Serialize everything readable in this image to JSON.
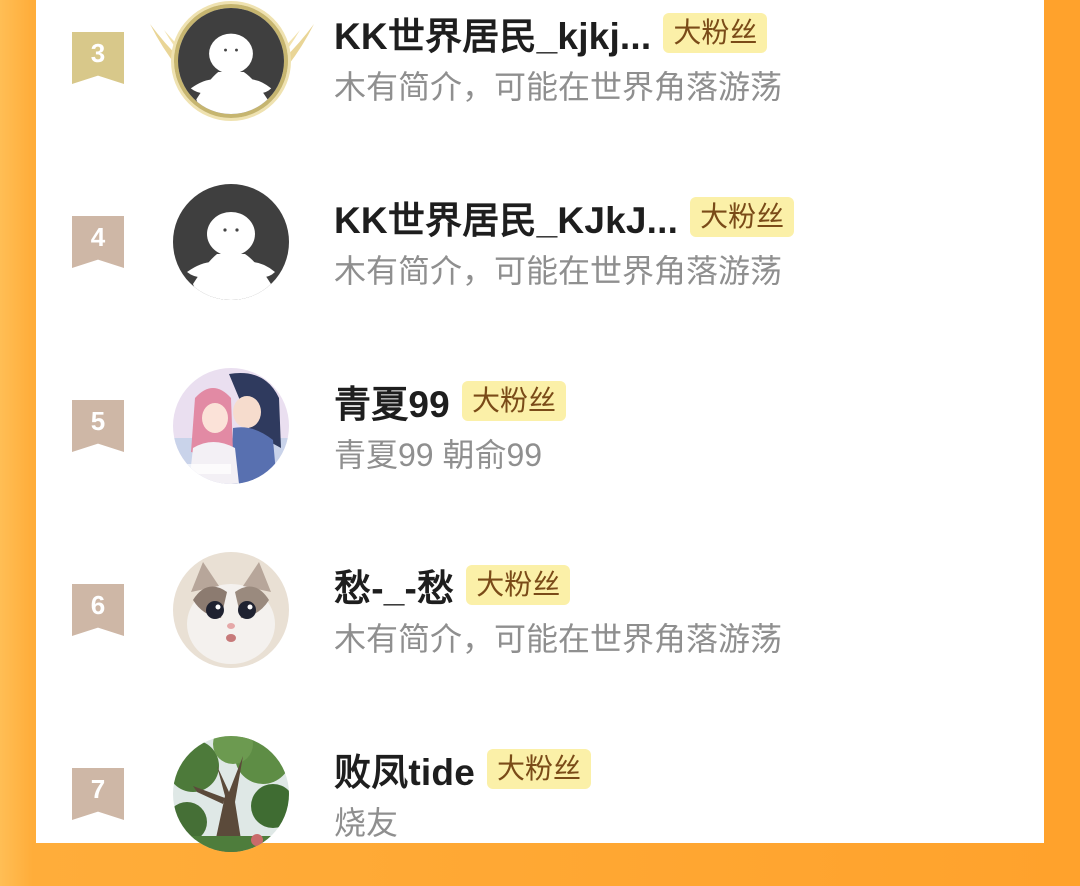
{
  "colors": {
    "background_orange": "#ffa22c",
    "card_white": "#ffffff",
    "badge_bg": "#fbf0a8",
    "badge_text": "#7a4b18",
    "name_text": "#1e1e1e",
    "bio_text": "#8f8f8f",
    "rank3_gold": "#d8c88a",
    "rank_tan": "#ceb7a6",
    "default_avatar_dark": "#3f3f3f"
  },
  "fans": [
    {
      "rank": "3",
      "name": "KK世界居民_kjkj...",
      "badge": "大粉丝",
      "bio": "木有简介，可能在世界角落游荡",
      "avatar": "default-avatar-gold-frame-icon"
    },
    {
      "rank": "4",
      "name": "KK世界居民_KJkJ...",
      "badge": "大粉丝",
      "bio": "木有简介，可能在世界角落游荡",
      "avatar": "default-avatar-icon"
    },
    {
      "rank": "5",
      "name": "青夏99",
      "badge": "大粉丝",
      "bio": "青夏99 朝俞99",
      "avatar": "anime-couple-avatar"
    },
    {
      "rank": "6",
      "name": "愁-_-愁",
      "badge": "大粉丝",
      "bio": "木有简介，可能在世界角落游荡",
      "avatar": "cat-avatar"
    },
    {
      "rank": "7",
      "name": "败凤tide",
      "badge": "大粉丝",
      "bio": "烧友",
      "avatar": "tree-photo-avatar"
    }
  ]
}
